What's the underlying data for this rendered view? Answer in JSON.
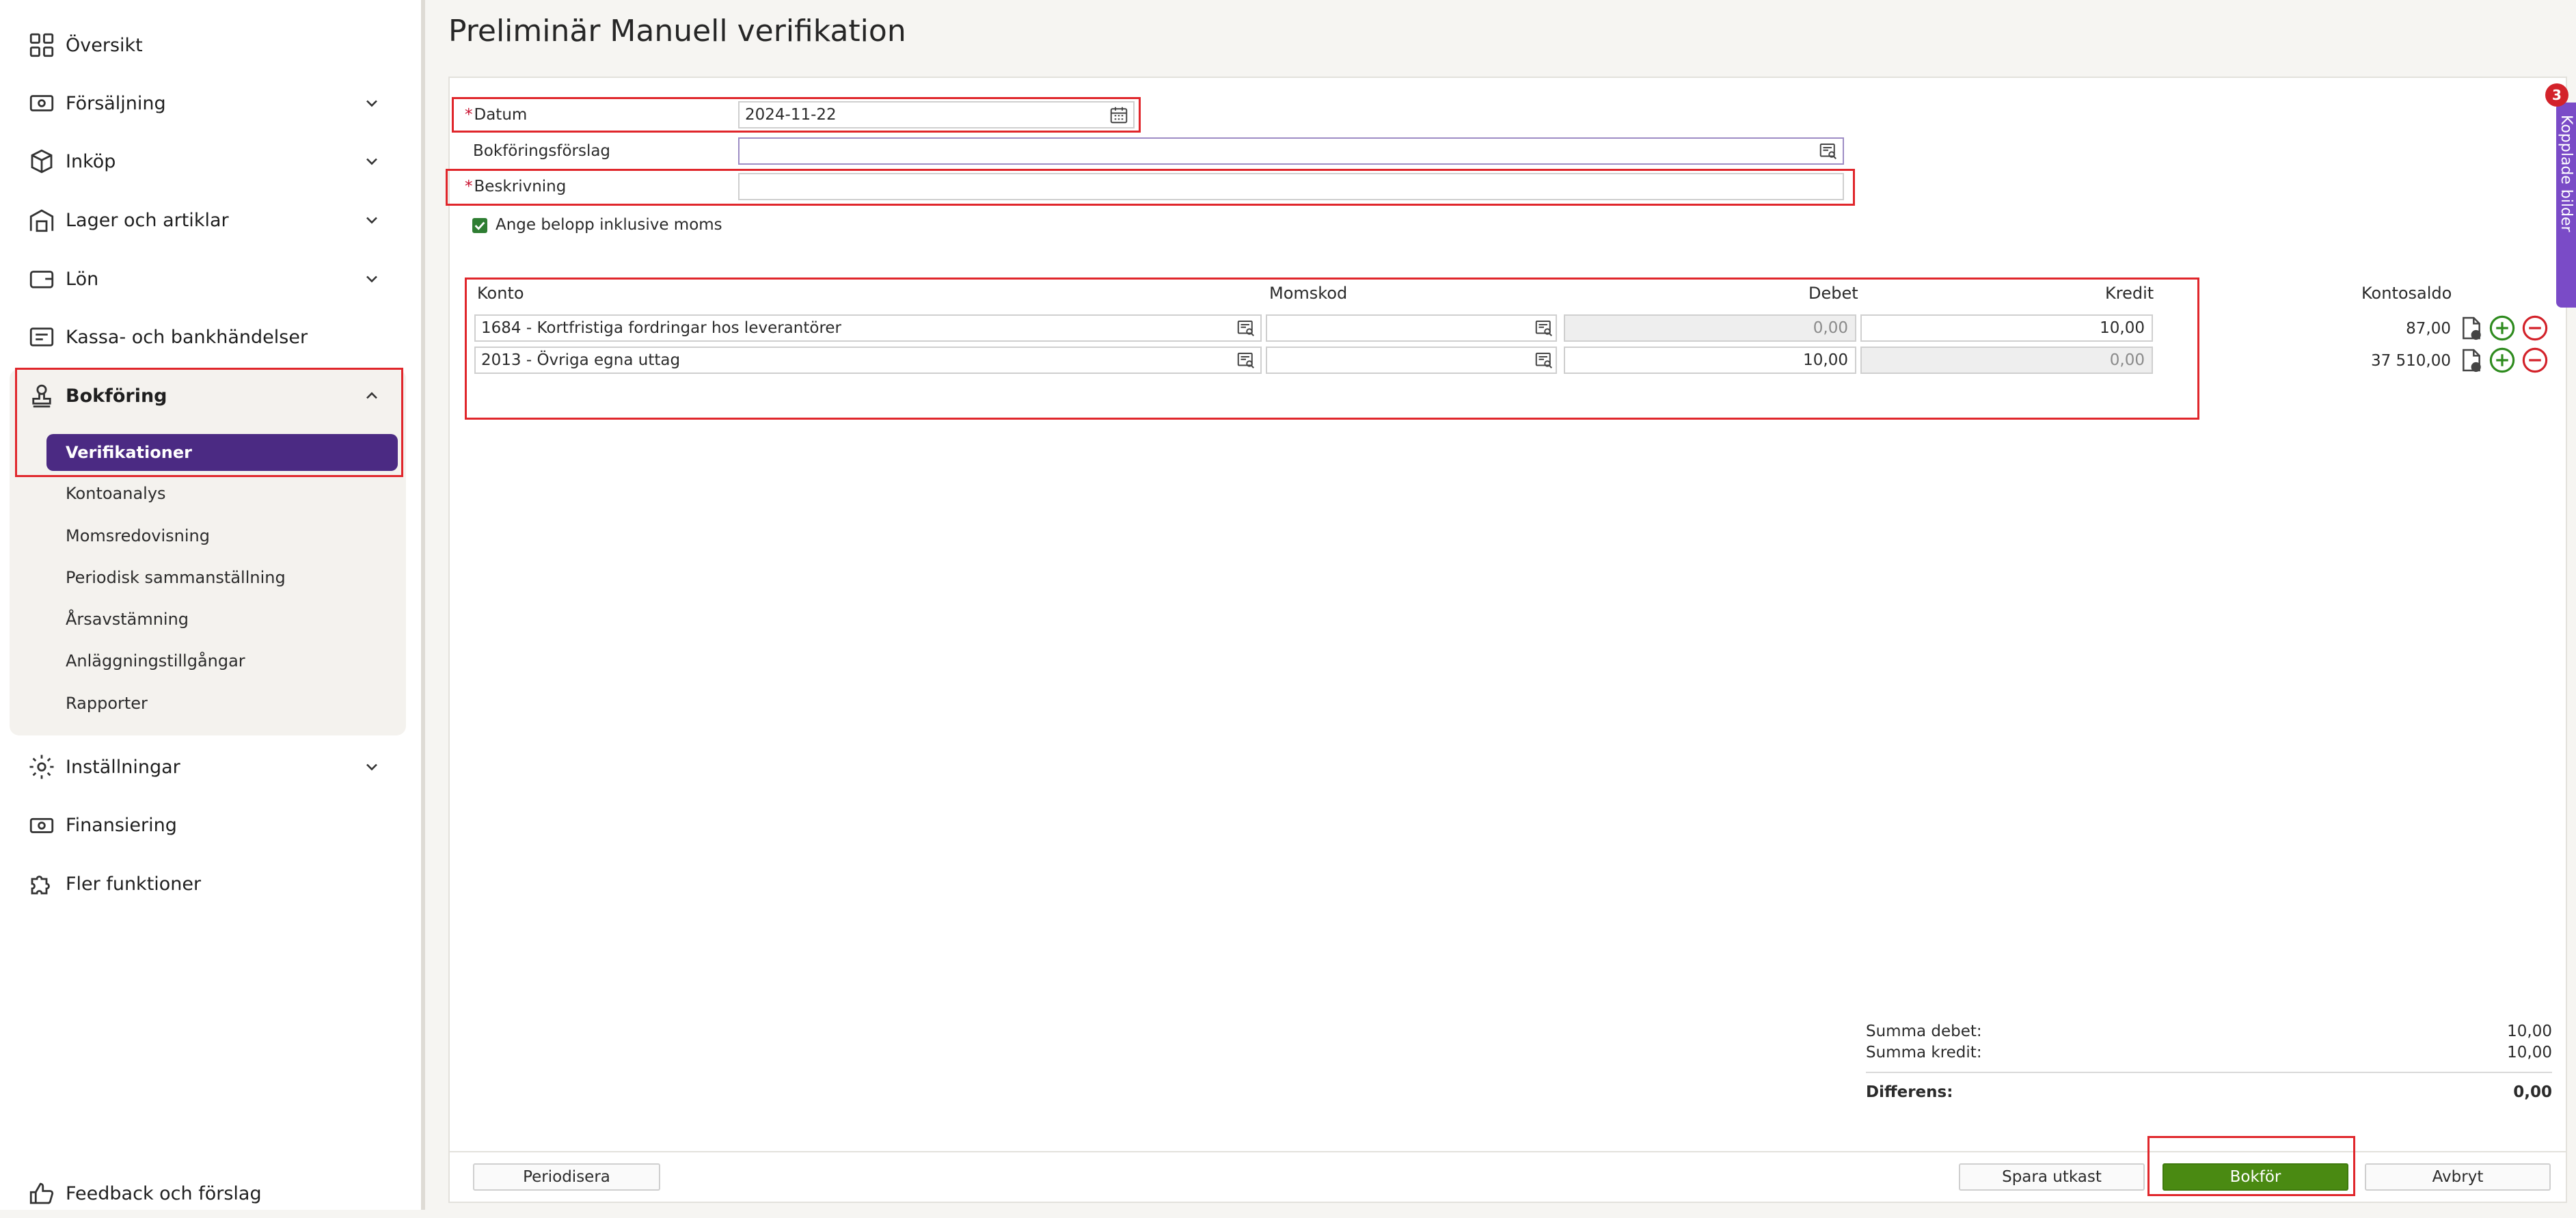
{
  "sidebar": {
    "items": [
      {
        "label": "Översikt"
      },
      {
        "label": "Försäljning"
      },
      {
        "label": "Inköp"
      },
      {
        "label": "Lager och artiklar"
      },
      {
        "label": "Lön"
      },
      {
        "label": "Kassa- och bankhändelser"
      },
      {
        "label": "Bokföring"
      },
      {
        "label": "Inställningar"
      },
      {
        "label": "Finansiering"
      },
      {
        "label": "Fler funktioner"
      },
      {
        "label": "Feedback och förslag"
      }
    ],
    "bokforing_sub": [
      {
        "label": "Verifikationer"
      },
      {
        "label": "Kontoanalys"
      },
      {
        "label": "Momsredovisning"
      },
      {
        "label": "Periodisk sammanställning"
      },
      {
        "label": "Årsavstämning"
      },
      {
        "label": "Anläggningstillgångar"
      },
      {
        "label": "Rapporter"
      }
    ]
  },
  "page": {
    "title": "Preliminär Manuell verifikation"
  },
  "form": {
    "required_mark": "*",
    "datum_label": "Datum",
    "datum_value": "2024-11-22",
    "forslag_label": "Bokföringsförslag",
    "forslag_value": "",
    "beskrivning_label": "Beskrivning",
    "beskrivning_value": "",
    "moms_checkbox_label": "Ange belopp inklusive moms",
    "moms_checkbox_checked": true
  },
  "table": {
    "headers": {
      "konto": "Konto",
      "momskod": "Momskod",
      "debet": "Debet",
      "kredit": "Kredit",
      "saldo": "Kontosaldo"
    },
    "rows": [
      {
        "konto": "1684 - Kortfristiga fordringar hos leverantörer",
        "momskod": "",
        "debet": "0,00",
        "kredit": "10,00",
        "saldo": "87,00"
      },
      {
        "konto": "2013 - Övriga egna uttag",
        "momskod": "",
        "debet": "10,00",
        "kredit": "0,00",
        "saldo": "37 510,00"
      }
    ]
  },
  "summary": {
    "debet_label": "Summa debet:",
    "debet_value": "10,00",
    "kredit_label": "Summa kredit:",
    "kredit_value": "10,00",
    "diff_label": "Differens:",
    "diff_value": "0,00"
  },
  "buttons": {
    "periodisera": "Periodisera",
    "spara_utkast": "Spara utkast",
    "bokfor": "Bokför",
    "avbryt": "Avbryt"
  },
  "side_tab": {
    "label": "Kopplade bilder",
    "badge_count": "3"
  },
  "colors": {
    "accent": "#4b2a83",
    "primary_button": "#4a8a12",
    "highlight": "#e0262b",
    "side_tab": "#7a4bc7"
  }
}
